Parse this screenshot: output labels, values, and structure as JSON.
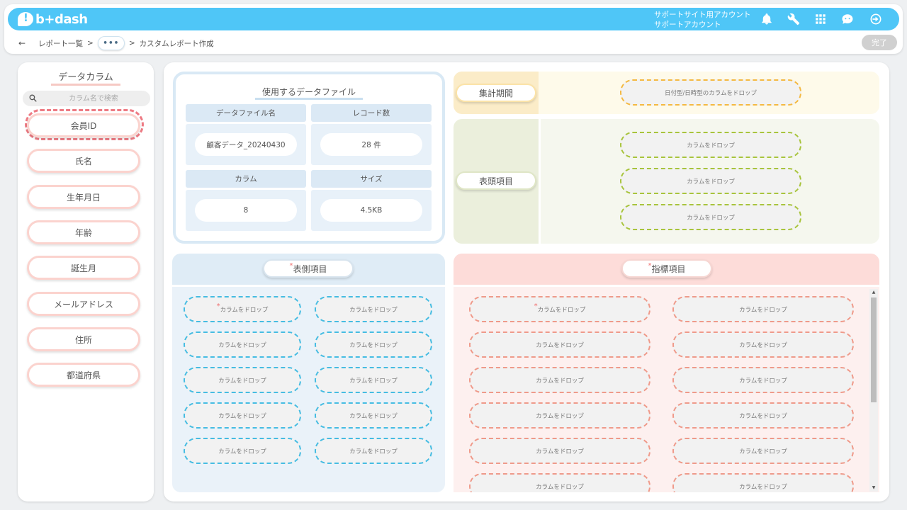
{
  "header": {
    "logo_text": "b+dash",
    "account_line1": "サポートサイト用アカウント",
    "account_line2": "サポートアカウント",
    "icons": [
      "bell-icon",
      "wrench-icon",
      "grid-icon",
      "chat-face-icon",
      "logout-icon"
    ]
  },
  "breadcrumb": {
    "back": "←",
    "report_list": "レポート一覧",
    "sep": ">",
    "dots": "•••",
    "current": "カスタムレポート作成"
  },
  "done_label": "完了",
  "sidebar": {
    "title": "データカラム",
    "search_placeholder": "カラム名で検索",
    "columns": [
      "会員ID",
      "氏名",
      "生年月日",
      "年齢",
      "誕生月",
      "メールアドレス",
      "住所",
      "都道府県"
    ]
  },
  "datafile": {
    "title": "使用するデータファイル",
    "name_label": "データファイル名",
    "name_value": "顧客データ_20240430",
    "records_label": "レコード数",
    "records_value": "28 件",
    "columns_label": "カラム",
    "columns_value": "8",
    "size_label": "サイズ",
    "size_value": "4.5KB"
  },
  "period": {
    "label": "集計期間",
    "drop": "日付型/日時型のカラムをドロップ"
  },
  "column_header": {
    "label": "表頭項目",
    "drop": "カラムをドロップ"
  },
  "row_header": {
    "label": "表側項目",
    "required_mark": "*",
    "drop": "カラムをドロップ"
  },
  "metrics": {
    "label": "指標項目",
    "required_mark": "*",
    "drop": "カラムをドロップ"
  },
  "colors": {
    "topbar": "#4fc6f7",
    "column_border": "#fbd3ce",
    "period_drop": "#f4b942",
    "header_drop": "#a8c43c",
    "side_drop": "#45bce2",
    "metric_drop": "#ef9a8a"
  }
}
